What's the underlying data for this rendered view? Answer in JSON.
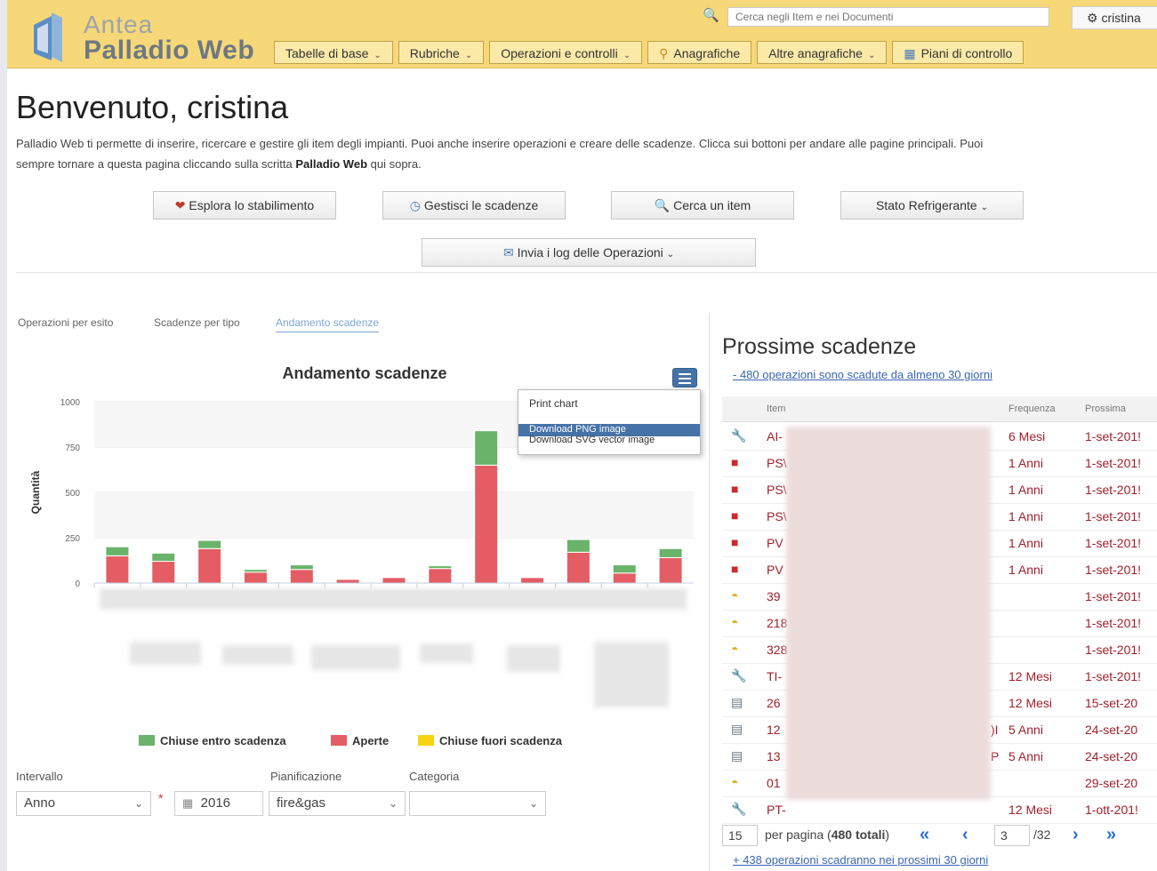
{
  "colors": {
    "header_bg": "#f6d878",
    "aperte": "#e45d64",
    "chiuse_entro": "#6ab36a",
    "chiuse_fuori": "#f5d50f",
    "accent": "#4572a7",
    "overdue": "#a21e2a"
  },
  "header": {
    "logo_line1": "Antea",
    "logo_line2": "Palladio Web",
    "search_placeholder": "Cerca negli Item e nei Documenti",
    "user": "cristina",
    "nav": [
      {
        "label": "Tabelle di base",
        "icon": "",
        "dropdown": true
      },
      {
        "label": "Rubriche",
        "icon": "",
        "dropdown": true
      },
      {
        "label": "Operazioni e controlli",
        "icon": "",
        "dropdown": true
      },
      {
        "label": "Anagrafiche",
        "icon": "tag-icon",
        "dropdown": false
      },
      {
        "label": "Altre anagrafiche",
        "icon": "",
        "dropdown": true
      },
      {
        "label": "Piani di controllo",
        "icon": "calendar-icon",
        "dropdown": false
      }
    ]
  },
  "welcome": {
    "title": "Benvenuto, cristina",
    "line1": "Palladio Web ti permette di inserire, ricercare e gestire gli item degli impianti. Puoi anche inserire operazioni e creare delle scadenze. Clicca sui bottoni per andare alle pagine principali. Puoi",
    "line2_pre": "sempre tornare a questa pagina cliccando sulla scritta ",
    "line2_bold": "Palladio Web",
    "line2_post": " qui sopra."
  },
  "buttons": {
    "explore": "Esplora lo stabilimento",
    "manage": "Gestisci le scadenze",
    "search": "Cerca un item",
    "refrigerant": "Stato Refrigerante",
    "send_logs": "Invia i log delle Operazioni"
  },
  "tabs": [
    "Operazioni per esito",
    "Scadenze per tipo",
    "Andamento scadenze"
  ],
  "chart_menu": [
    "Print chart",
    "Download PNG image",
    "Download SVG vector image"
  ],
  "chart_data": {
    "type": "bar",
    "title": "Andamento scadenze",
    "ylabel": "Quantità",
    "ylim": [
      0,
      1000
    ],
    "yticks": [
      "1000",
      "750",
      "500",
      "250",
      "0"
    ],
    "categories_count": 13,
    "series": [
      {
        "name": "Aperte",
        "values": [
          150,
          120,
          190,
          60,
          75,
          20,
          30,
          80,
          650,
          30,
          170,
          55,
          140
        ]
      },
      {
        "name": "Chiuse entro scadenza",
        "values": [
          50,
          45,
          45,
          15,
          25,
          0,
          0,
          15,
          190,
          0,
          70,
          45,
          50
        ]
      },
      {
        "name": "Chiuse fuori scadenza",
        "values": [
          0,
          0,
          0,
          0,
          0,
          0,
          0,
          0,
          0,
          0,
          0,
          0,
          0
        ]
      }
    ],
    "legend": [
      "Chiuse entro scadenza",
      "Aperte",
      "Chiuse fuori scadenza"
    ],
    "legend_position": "bottom"
  },
  "filters": {
    "interval_label": "Intervallo",
    "interval_value": "Anno",
    "required_mark": "*",
    "year": "2016",
    "plan_label": "Pianificazione",
    "plan_value": "fire&gas",
    "category_label": "Categoria",
    "category_value": ""
  },
  "scadenze": {
    "title": "Prossime scadenze",
    "overdue_link": "- 480 operazioni sono scadute da almeno 30 giorni",
    "columns": [
      "Item",
      "Frequenza",
      "Prossima"
    ],
    "rows": [
      {
        "icon": "wrench-icon",
        "item": "AI-",
        "prefix": "",
        "freq": "6 Mesi",
        "next": "1-set-201!"
      },
      {
        "icon": "extinguisher-icon",
        "item": "PS\\",
        "prefix": "",
        "freq": "1 Anni",
        "next": "1-set-201!"
      },
      {
        "icon": "extinguisher-icon",
        "item": "PS\\",
        "prefix": "",
        "freq": "1 Anni",
        "next": "1-set-201!"
      },
      {
        "icon": "extinguisher-icon",
        "item": "PS\\",
        "prefix": "",
        "freq": "1 Anni",
        "next": "1-set-201!"
      },
      {
        "icon": "extinguisher-icon",
        "item": "PV",
        "prefix": "",
        "freq": "1 Anni",
        "next": "1-set-201!"
      },
      {
        "icon": "extinguisher-icon",
        "item": "PV",
        "prefix": "",
        "freq": "1 Anni",
        "next": "1-set-201!"
      },
      {
        "icon": "helmet-icon",
        "item": "39",
        "prefix": "",
        "freq": "",
        "next": "1-set-201!"
      },
      {
        "icon": "helmet-icon",
        "item": "218",
        "prefix": "",
        "freq": "",
        "next": "1-set-201!"
      },
      {
        "icon": "helmet-icon",
        "item": "328",
        "prefix": "",
        "freq": "",
        "next": "1-set-201!"
      },
      {
        "icon": "wrench-icon",
        "item": "TI-",
        "prefix": "",
        "freq": "12 Mesi",
        "next": "1-set-201!"
      },
      {
        "icon": "document-icon",
        "item": "26",
        "prefix": "",
        "freq": "12 Mesi",
        "next": "15-set-20"
      },
      {
        "icon": "document-icon",
        "item": "12",
        "prefix": ")I",
        "freq": "5 Anni",
        "next": "24-set-20"
      },
      {
        "icon": "document-icon",
        "item": "13",
        "prefix": "P",
        "freq": "5 Anni",
        "next": "24-set-20"
      },
      {
        "icon": "helmet-icon",
        "item": "01",
        "prefix": "",
        "freq": "",
        "next": "29-set-20"
      },
      {
        "icon": "wrench-icon",
        "item": "PT-",
        "prefix": "",
        "freq": "12 Mesi",
        "next": "1-ott-201!"
      }
    ],
    "pager": {
      "per_page": "15",
      "per_page_label": "per pagina (",
      "total": "480 totali",
      "close": ")",
      "page": "3",
      "of": "/32"
    },
    "bottom_link": "+ 438 operazioni scadranno nei prossimi 30 giorni"
  }
}
